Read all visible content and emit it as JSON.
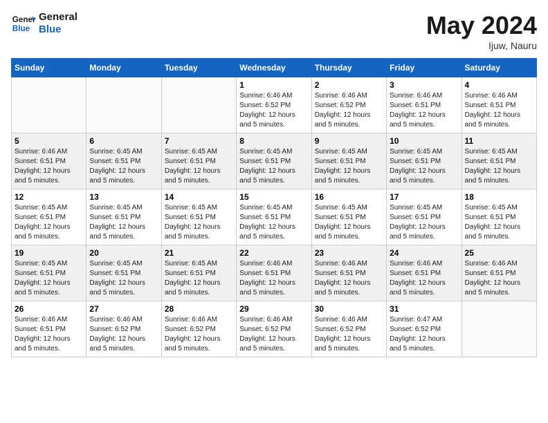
{
  "header": {
    "logo_line1": "General",
    "logo_line2": "Blue",
    "month": "May 2024",
    "location": "Ijuw, Nauru"
  },
  "weekdays": [
    "Sunday",
    "Monday",
    "Tuesday",
    "Wednesday",
    "Thursday",
    "Friday",
    "Saturday"
  ],
  "weeks": [
    [
      {
        "day": "",
        "sunrise": "",
        "sunset": "",
        "daylight": ""
      },
      {
        "day": "",
        "sunrise": "",
        "sunset": "",
        "daylight": ""
      },
      {
        "day": "",
        "sunrise": "",
        "sunset": "",
        "daylight": ""
      },
      {
        "day": "1",
        "sunrise": "Sunrise: 6:46 AM",
        "sunset": "Sunset: 6:52 PM",
        "daylight": "Daylight: 12 hours and 5 minutes."
      },
      {
        "day": "2",
        "sunrise": "Sunrise: 6:46 AM",
        "sunset": "Sunset: 6:52 PM",
        "daylight": "Daylight: 12 hours and 5 minutes."
      },
      {
        "day": "3",
        "sunrise": "Sunrise: 6:46 AM",
        "sunset": "Sunset: 6:51 PM",
        "daylight": "Daylight: 12 hours and 5 minutes."
      },
      {
        "day": "4",
        "sunrise": "Sunrise: 6:46 AM",
        "sunset": "Sunset: 6:51 PM",
        "daylight": "Daylight: 12 hours and 5 minutes."
      }
    ],
    [
      {
        "day": "5",
        "sunrise": "Sunrise: 6:46 AM",
        "sunset": "Sunset: 6:51 PM",
        "daylight": "Daylight: 12 hours and 5 minutes."
      },
      {
        "day": "6",
        "sunrise": "Sunrise: 6:45 AM",
        "sunset": "Sunset: 6:51 PM",
        "daylight": "Daylight: 12 hours and 5 minutes."
      },
      {
        "day": "7",
        "sunrise": "Sunrise: 6:45 AM",
        "sunset": "Sunset: 6:51 PM",
        "daylight": "Daylight: 12 hours and 5 minutes."
      },
      {
        "day": "8",
        "sunrise": "Sunrise: 6:45 AM",
        "sunset": "Sunset: 6:51 PM",
        "daylight": "Daylight: 12 hours and 5 minutes."
      },
      {
        "day": "9",
        "sunrise": "Sunrise: 6:45 AM",
        "sunset": "Sunset: 6:51 PM",
        "daylight": "Daylight: 12 hours and 5 minutes."
      },
      {
        "day": "10",
        "sunrise": "Sunrise: 6:45 AM",
        "sunset": "Sunset: 6:51 PM",
        "daylight": "Daylight: 12 hours and 5 minutes."
      },
      {
        "day": "11",
        "sunrise": "Sunrise: 6:45 AM",
        "sunset": "Sunset: 6:51 PM",
        "daylight": "Daylight: 12 hours and 5 minutes."
      }
    ],
    [
      {
        "day": "12",
        "sunrise": "Sunrise: 6:45 AM",
        "sunset": "Sunset: 6:51 PM",
        "daylight": "Daylight: 12 hours and 5 minutes."
      },
      {
        "day": "13",
        "sunrise": "Sunrise: 6:45 AM",
        "sunset": "Sunset: 6:51 PM",
        "daylight": "Daylight: 12 hours and 5 minutes."
      },
      {
        "day": "14",
        "sunrise": "Sunrise: 6:45 AM",
        "sunset": "Sunset: 6:51 PM",
        "daylight": "Daylight: 12 hours and 5 minutes."
      },
      {
        "day": "15",
        "sunrise": "Sunrise: 6:45 AM",
        "sunset": "Sunset: 6:51 PM",
        "daylight": "Daylight: 12 hours and 5 minutes."
      },
      {
        "day": "16",
        "sunrise": "Sunrise: 6:45 AM",
        "sunset": "Sunset: 6:51 PM",
        "daylight": "Daylight: 12 hours and 5 minutes."
      },
      {
        "day": "17",
        "sunrise": "Sunrise: 6:45 AM",
        "sunset": "Sunset: 6:51 PM",
        "daylight": "Daylight: 12 hours and 5 minutes."
      },
      {
        "day": "18",
        "sunrise": "Sunrise: 6:45 AM",
        "sunset": "Sunset: 6:51 PM",
        "daylight": "Daylight: 12 hours and 5 minutes."
      }
    ],
    [
      {
        "day": "19",
        "sunrise": "Sunrise: 6:45 AM",
        "sunset": "Sunset: 6:51 PM",
        "daylight": "Daylight: 12 hours and 5 minutes."
      },
      {
        "day": "20",
        "sunrise": "Sunrise: 6:45 AM",
        "sunset": "Sunset: 6:51 PM",
        "daylight": "Daylight: 12 hours and 5 minutes."
      },
      {
        "day": "21",
        "sunrise": "Sunrise: 6:45 AM",
        "sunset": "Sunset: 6:51 PM",
        "daylight": "Daylight: 12 hours and 5 minutes."
      },
      {
        "day": "22",
        "sunrise": "Sunrise: 6:46 AM",
        "sunset": "Sunset: 6:51 PM",
        "daylight": "Daylight: 12 hours and 5 minutes."
      },
      {
        "day": "23",
        "sunrise": "Sunrise: 6:46 AM",
        "sunset": "Sunset: 6:51 PM",
        "daylight": "Daylight: 12 hours and 5 minutes."
      },
      {
        "day": "24",
        "sunrise": "Sunrise: 6:46 AM",
        "sunset": "Sunset: 6:51 PM",
        "daylight": "Daylight: 12 hours and 5 minutes."
      },
      {
        "day": "25",
        "sunrise": "Sunrise: 6:46 AM",
        "sunset": "Sunset: 6:51 PM",
        "daylight": "Daylight: 12 hours and 5 minutes."
      }
    ],
    [
      {
        "day": "26",
        "sunrise": "Sunrise: 6:46 AM",
        "sunset": "Sunset: 6:51 PM",
        "daylight": "Daylight: 12 hours and 5 minutes."
      },
      {
        "day": "27",
        "sunrise": "Sunrise: 6:46 AM",
        "sunset": "Sunset: 6:52 PM",
        "daylight": "Daylight: 12 hours and 5 minutes."
      },
      {
        "day": "28",
        "sunrise": "Sunrise: 6:46 AM",
        "sunset": "Sunset: 6:52 PM",
        "daylight": "Daylight: 12 hours and 5 minutes."
      },
      {
        "day": "29",
        "sunrise": "Sunrise: 6:46 AM",
        "sunset": "Sunset: 6:52 PM",
        "daylight": "Daylight: 12 hours and 5 minutes."
      },
      {
        "day": "30",
        "sunrise": "Sunrise: 6:46 AM",
        "sunset": "Sunset: 6:52 PM",
        "daylight": "Daylight: 12 hours and 5 minutes."
      },
      {
        "day": "31",
        "sunrise": "Sunrise: 6:47 AM",
        "sunset": "Sunset: 6:52 PM",
        "daylight": "Daylight: 12 hours and 5 minutes."
      },
      {
        "day": "",
        "sunrise": "",
        "sunset": "",
        "daylight": ""
      }
    ]
  ]
}
